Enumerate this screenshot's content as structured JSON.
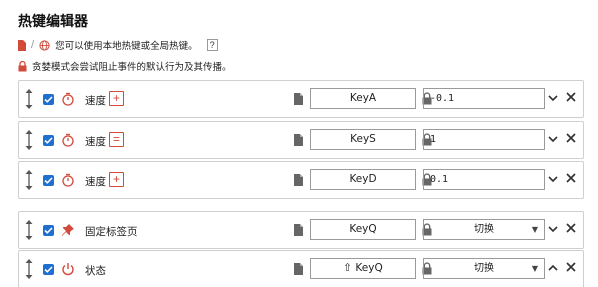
{
  "header": {
    "title": "热键编辑器",
    "info_line1": "您可以使用本地热键或全局热键。",
    "help_label": "?",
    "info_line2": "贪婪模式会尝试阻止事件的默认行为及其传播。"
  },
  "colors": {
    "accent": "#1f6fd1",
    "danger": "#d24a3a",
    "border": "#cfcfcf"
  },
  "rows": [
    {
      "icon": "timer-icon",
      "label": "速度",
      "op": "+",
      "op_icon": "plus-icon",
      "key": "KeyA",
      "value": "-0.1",
      "value_kind": "text",
      "expand": "down"
    },
    {
      "icon": "timer-icon",
      "label": "速度",
      "op": "=",
      "op_icon": "equals-icon",
      "key": "KeyS",
      "value": "1",
      "value_kind": "text",
      "expand": "down"
    },
    {
      "icon": "timer-icon",
      "label": "速度",
      "op": "+",
      "op_icon": "plus-icon",
      "key": "KeyD",
      "value": "0.1",
      "value_kind": "text",
      "expand": "down"
    },
    {
      "icon": "pin-icon",
      "label": "固定标签页",
      "key": "KeyQ",
      "value": "切换",
      "value_kind": "select",
      "expand": "down"
    },
    {
      "icon": "power-icon",
      "label": "状态",
      "key": "⇧ KeyQ",
      "value": "切换",
      "value_kind": "select",
      "expand": "up"
    }
  ]
}
